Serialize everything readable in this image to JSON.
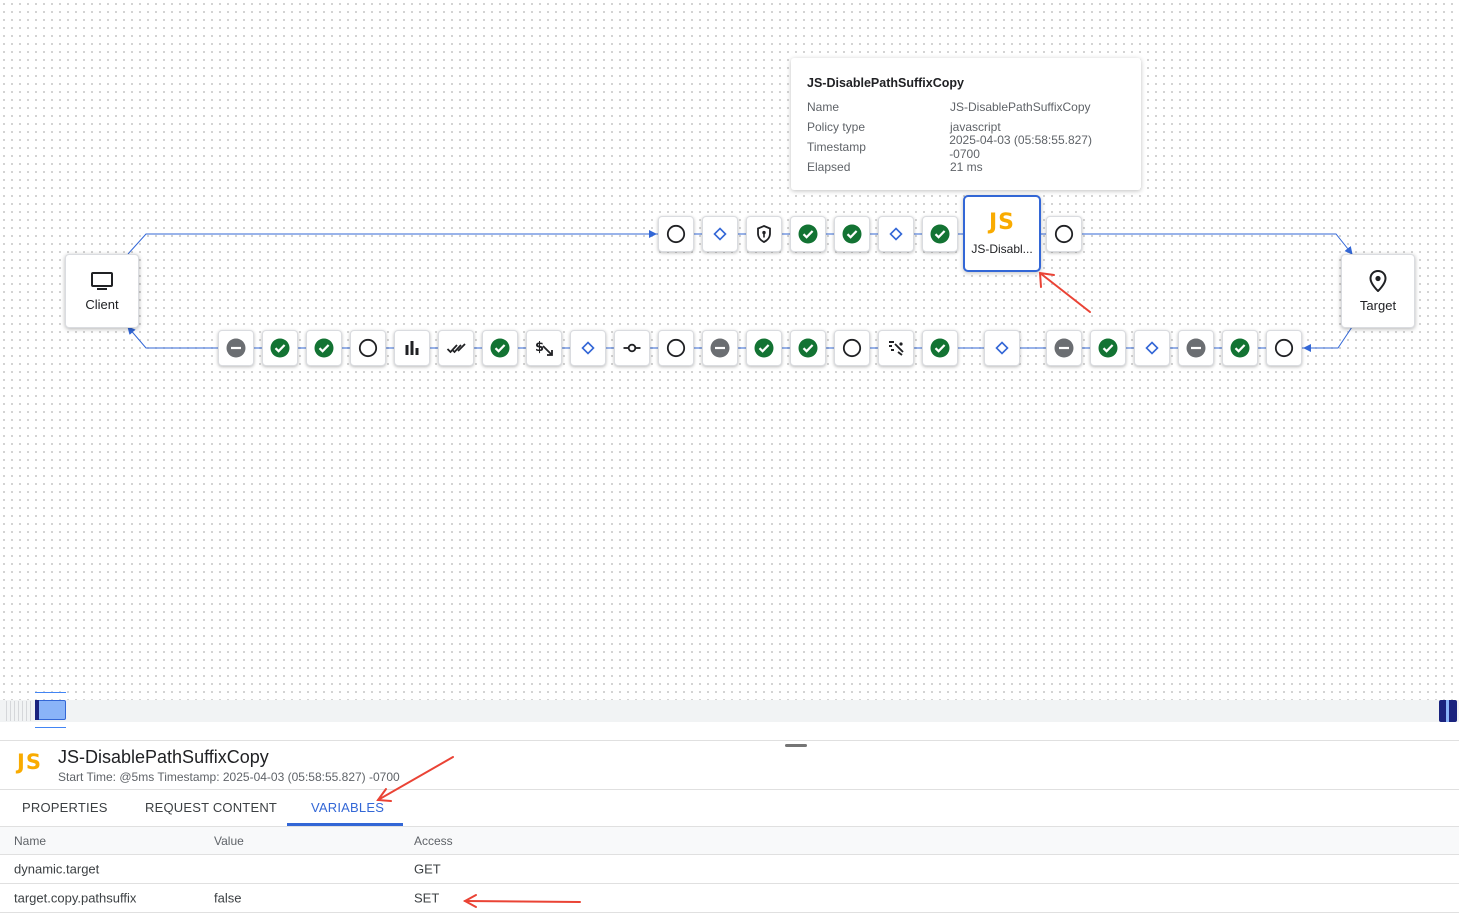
{
  "flow": {
    "client_label": "Client",
    "target_label": "Target",
    "selected_policy_label": "JS-Disabl...",
    "selected_policy_glyph": "JS"
  },
  "tooltip": {
    "title": "JS-DisablePathSuffixCopy",
    "rows": [
      {
        "key": "Name",
        "value": "JS-DisablePathSuffixCopy"
      },
      {
        "key": "Policy type",
        "value": "javascript"
      },
      {
        "key": "Timestamp",
        "value": "2025-04-03 (05:58:55.827) -0700"
      },
      {
        "key": "Elapsed",
        "value": "21 ms"
      }
    ]
  },
  "detail": {
    "icon_glyph": "JS",
    "title": "JS-DisablePathSuffixCopy",
    "subtitle": "Start Time: @5ms Timestamp: 2025-04-03 (05:58:55.827) -0700"
  },
  "tabs": [
    {
      "label": "PROPERTIES",
      "active": false
    },
    {
      "label": "REQUEST CONTENT",
      "active": false
    },
    {
      "label": "VARIABLES",
      "active": true
    }
  ],
  "variables_table": {
    "headers": [
      "Name",
      "Value",
      "Access"
    ],
    "rows": [
      {
        "name": "dynamic.target",
        "value": "",
        "access": "GET"
      },
      {
        "name": "target.copy.pathsuffix",
        "value": "false",
        "access": "SET"
      }
    ]
  },
  "colors": {
    "accent": "#3367d6",
    "success": "#137333",
    "js": "#f9ab00",
    "annotation": "#ea4335"
  }
}
